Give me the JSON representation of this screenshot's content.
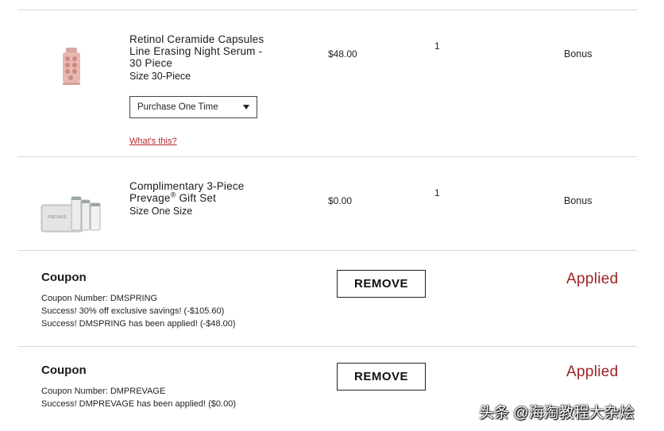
{
  "items": [
    {
      "title_lines": [
        "Retinol Ceramide Capsules",
        "Line Erasing Night Serum -",
        "30 Piece"
      ],
      "size": "Size 30-Piece",
      "price": "$48.00",
      "qty": "1",
      "status": "Bonus",
      "purchase_option": "Purchase One Time",
      "whats_this": "What's this?"
    },
    {
      "title_line1": "Complimentary 3-Piece",
      "title_line2_pre": "Prevage",
      "title_line2_sup": "®",
      "title_line2_post": " Gift Set",
      "size": "Size One Size",
      "price": "$0.00",
      "qty": "1",
      "status": "Bonus"
    }
  ],
  "coupons": [
    {
      "heading": "Coupon",
      "lines": [
        "Coupon Number: DMSPRING",
        "Success! 30% off exclusive savings! (-$105.60)",
        "Success! DMSPRING has been applied! (-$48.00)"
      ],
      "button": "REMOVE",
      "status": "Applied"
    },
    {
      "heading": "Coupon",
      "lines": [
        "Coupon Number: DMPREVAGE",
        "Success! DMPREVAGE has been applied! ($0.00)"
      ],
      "button": "REMOVE",
      "status": "Applied"
    }
  ],
  "watermark": "头条 @海淘教程大杂烩",
  "colors": {
    "accent": "#9e2222",
    "link": "#b3262d",
    "divider": "#d9d9d9"
  }
}
